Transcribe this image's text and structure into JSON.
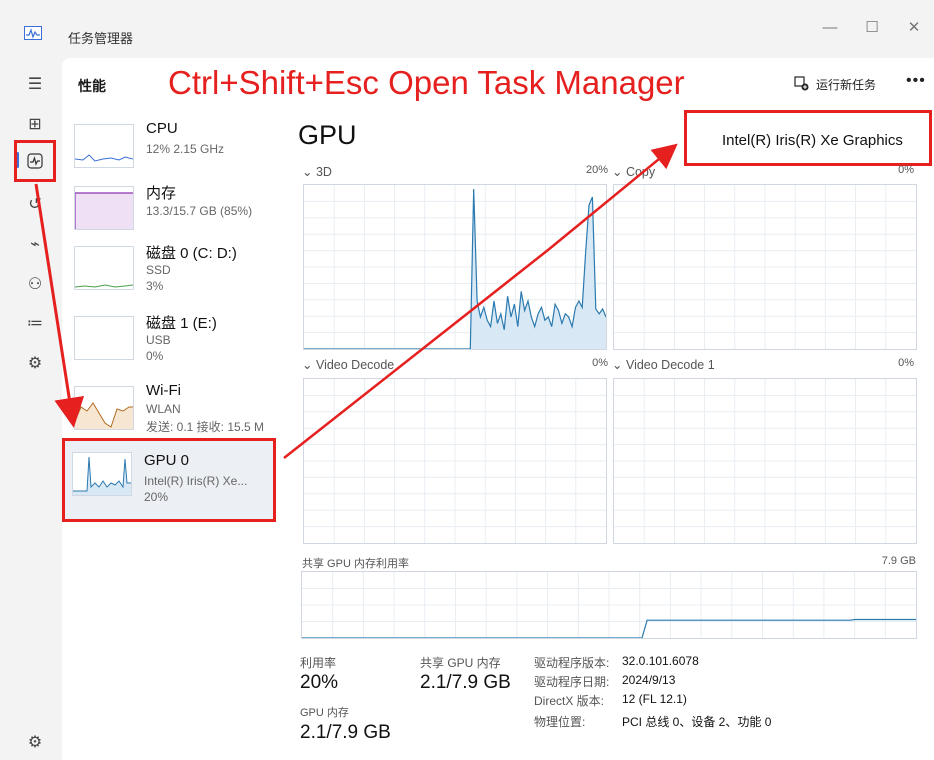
{
  "window": {
    "title": "任务管理器",
    "controls": {
      "minimize": "—",
      "maximize": "☐",
      "close": "✕"
    }
  },
  "header": {
    "page_title": "性能",
    "run_task_label": "运行新任务",
    "more_label": "•••"
  },
  "annotation": {
    "text": "Ctrl+Shift+Esc Open Task Manager",
    "color": "#e5201f"
  },
  "devices": [
    {
      "name": "CPU",
      "line1": "12%  2.15 GHz",
      "line2": "",
      "line3": "",
      "color": "#3a6fd8"
    },
    {
      "name": "内存",
      "line1": "13.3/15.7 GB (85%)",
      "line2": "",
      "line3": "",
      "color": "#8a35b0"
    },
    {
      "name": "磁盘 0 (C: D:)",
      "line1": "SSD",
      "line2": "3%",
      "line3": "",
      "color": "#4aa04a"
    },
    {
      "name": "磁盘 1 (E:)",
      "line1": "USB",
      "line2": "0%",
      "line3": "",
      "color": "#4aa04a"
    },
    {
      "name": "Wi-Fi",
      "line1": "WLAN",
      "line2": "发送: 0.1  接收: 15.5 M",
      "line3": "",
      "color": "#b06a20"
    },
    {
      "name": "GPU 0",
      "line1": "Intel(R) Iris(R) Xe...",
      "line2": "20%",
      "line3": "",
      "color": "#2a7ab0"
    }
  ],
  "gpu": {
    "title": "GPU",
    "model": "Intel(R) Iris(R) Xe Graphics",
    "engines": [
      {
        "name": "3D",
        "pct": "20%"
      },
      {
        "name": "Copy",
        "pct": "0%"
      },
      {
        "name": "Video Decode",
        "pct": "0%"
      },
      {
        "name": "Video Decode 1",
        "pct": "0%"
      }
    ],
    "shared_mem_label": "共享 GPU 内存利用率",
    "shared_mem_max": "7.9 GB",
    "stats": {
      "util_label": "利用率",
      "util_value": "20%",
      "shared_label": "共享 GPU 内存",
      "shared_value": "2.1/7.9 GB",
      "gpu_mem_label": "GPU 内存",
      "gpu_mem_value": "2.1/7.9 GB"
    },
    "info": [
      {
        "k": "驱动程序版本:",
        "v": "32.0.101.6078"
      },
      {
        "k": "驱动程序日期:",
        "v": "2024/9/13"
      },
      {
        "k": "DirectX 版本:",
        "v": "12 (FL 12.1)"
      },
      {
        "k": "物理位置:",
        "v": "PCI 总线 0、设备 2、功能 0"
      }
    ],
    "graph_3d_series": [
      0,
      0,
      0,
      0,
      0,
      0,
      0,
      0,
      0,
      0,
      0,
      0,
      0,
      0,
      0,
      0,
      0,
      0,
      0,
      0,
      0,
      0,
      0,
      0,
      0,
      0,
      0,
      0,
      0,
      0,
      0,
      0,
      0,
      0,
      0,
      0,
      0,
      0,
      0,
      0,
      0,
      0,
      0,
      0,
      0,
      0,
      0,
      0,
      0,
      0,
      100,
      30,
      20,
      26,
      18,
      14,
      30,
      16,
      22,
      12,
      33,
      20,
      28,
      14,
      36,
      24,
      30,
      20,
      14,
      22,
      26,
      18,
      20,
      14,
      28,
      24,
      16,
      22,
      20,
      14,
      26,
      30,
      26,
      60,
      90,
      95,
      25,
      22,
      25,
      20
    ],
    "shared_mem_series": [
      0,
      0,
      0,
      0,
      0,
      0,
      0,
      0,
      0,
      0,
      0,
      0,
      0,
      0,
      0,
      0,
      0,
      0,
      0,
      0,
      0,
      0,
      0,
      0,
      0,
      0,
      0,
      0,
      0,
      0,
      0,
      0,
      0,
      0,
      0,
      0,
      0,
      0,
      0,
      0,
      0,
      0,
      0,
      0,
      0,
      0,
      0,
      0,
      0,
      0,
      0,
      0,
      0,
      0,
      0,
      0,
      0,
      0,
      0,
      0,
      0,
      0,
      0,
      0,
      0,
      0,
      0,
      0,
      27,
      27,
      27,
      27,
      27,
      27,
      27,
      27,
      27,
      27,
      27,
      27,
      27,
      27,
      27,
      27,
      27,
      27,
      27,
      27,
      27,
      27,
      27,
      27,
      27,
      27,
      27,
      27,
      27,
      27,
      27,
      27,
      27,
      27,
      27,
      27,
      27,
      27,
      27,
      27,
      27,
      28,
      28,
      28,
      28,
      28,
      28,
      28,
      28,
      28,
      28,
      28,
      28,
      28
    ]
  },
  "colors": {
    "accent": "#3a6fd8",
    "gpu_line": "#2a7ab0",
    "gpu_fill": "#d9e8f5",
    "annotation": "#e5201f"
  },
  "rail_icons": [
    "hamburger-icon",
    "processes-icon",
    "performance-icon",
    "app-history-icon",
    "startup-apps-icon",
    "users-icon",
    "details-icon",
    "services-icon",
    "settings-icon"
  ]
}
